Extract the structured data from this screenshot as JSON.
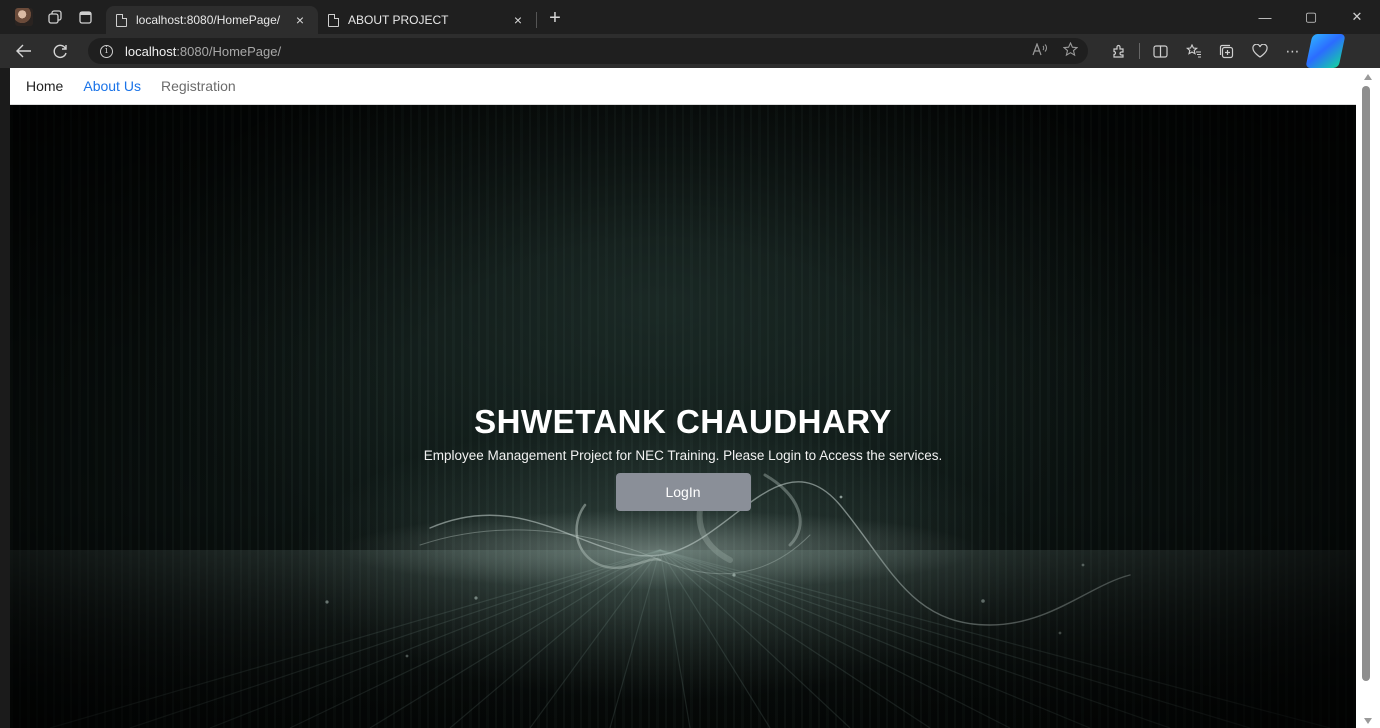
{
  "browser": {
    "tabs": [
      {
        "title": "localhost:8080/HomePage/",
        "active": true
      },
      {
        "title": "ABOUT PROJECT",
        "active": false
      }
    ],
    "tab_close_glyph": "×",
    "new_tab_glyph": "+",
    "url": {
      "host": "localhost",
      "rest": ":8080/HomePage/"
    },
    "window_controls": {
      "minimize": "—",
      "maximize": "▢",
      "close": "✕"
    }
  },
  "navbar": {
    "items": [
      {
        "label": "Home"
      },
      {
        "label": "About Us"
      },
      {
        "label": "Registration"
      }
    ]
  },
  "hero": {
    "title": "SHWETANK CHAUDHARY",
    "subtitle": "Employee Management Project for NEC Training. Please Login to Access the services.",
    "login_label": "LogIn"
  },
  "colors": {
    "nav_active_link": "#1a73e8",
    "login_button_bg": "#8a8f98",
    "hero_bg": "#0b1311"
  }
}
